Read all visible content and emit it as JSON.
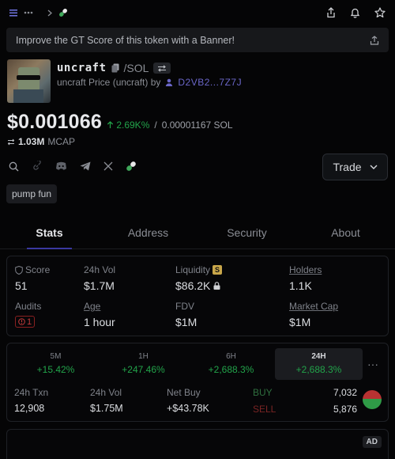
{
  "topbar": {
    "chevron": "›",
    "icons": [
      "menu-icon",
      "more-icon",
      "chevron-right-icon",
      "pill-icon",
      "share-icon",
      "bell-icon",
      "star-icon"
    ]
  },
  "banner": {
    "text": "Improve the GT Score of this token with a Banner!"
  },
  "token": {
    "symbol": "uncraft",
    "pair": "/SOL",
    "subtitle": "uncraft Price (uncraft) by",
    "creator": "D2VB2...7Z7J"
  },
  "price": {
    "value": "$0.001066",
    "change": "2.69K%",
    "separator": "/",
    "sol_value": "0.00001167 SOL"
  },
  "mcap": {
    "value": "1.03M",
    "label": "MCAP"
  },
  "trade_button": {
    "label": "Trade"
  },
  "tag": {
    "label": "pump fun"
  },
  "tabs": [
    {
      "label": "Stats"
    },
    {
      "label": "Address"
    },
    {
      "label": "Security"
    },
    {
      "label": "About"
    }
  ],
  "stats": {
    "score": {
      "label": "Score",
      "value": "51"
    },
    "vol24": {
      "label": "24h Vol",
      "value": "$1.7M"
    },
    "liquidity": {
      "label": "Liquidity",
      "badge": "S",
      "value": "$86.2K"
    },
    "holders": {
      "label": "Holders",
      "value": "1.1K"
    },
    "audits": {
      "label": "Audits",
      "value": "1"
    },
    "age": {
      "label": "Age",
      "value": "1 hour"
    },
    "fdv": {
      "label": "FDV",
      "value": "$1M"
    },
    "marketcap": {
      "label": "Market Cap",
      "value": "$1M"
    }
  },
  "periods": [
    {
      "name": "5M",
      "change": "+15.42%"
    },
    {
      "name": "1H",
      "change": "+247.46%"
    },
    {
      "name": "6H",
      "change": "+2,688.3%"
    },
    {
      "name": "24H",
      "change": "+2,688.3%"
    }
  ],
  "periods_more": "···",
  "tx": {
    "txn": {
      "label": "24h Txn",
      "value": "12,908"
    },
    "vol": {
      "label": "24h Vol",
      "value": "$1.75M"
    },
    "netbuy": {
      "label": "Net Buy",
      "value": "+$43.78K"
    },
    "buy": {
      "label": "BUY",
      "value": "7,032"
    },
    "sell": {
      "label": "SELL",
      "value": "5,876"
    },
    "buy_fraction": 0.545
  },
  "ad": {
    "label": "AD"
  },
  "colors": {
    "green": "#22a34a",
    "red": "#b83232",
    "accent": "#3a38a0",
    "orange": "#d6782a"
  }
}
